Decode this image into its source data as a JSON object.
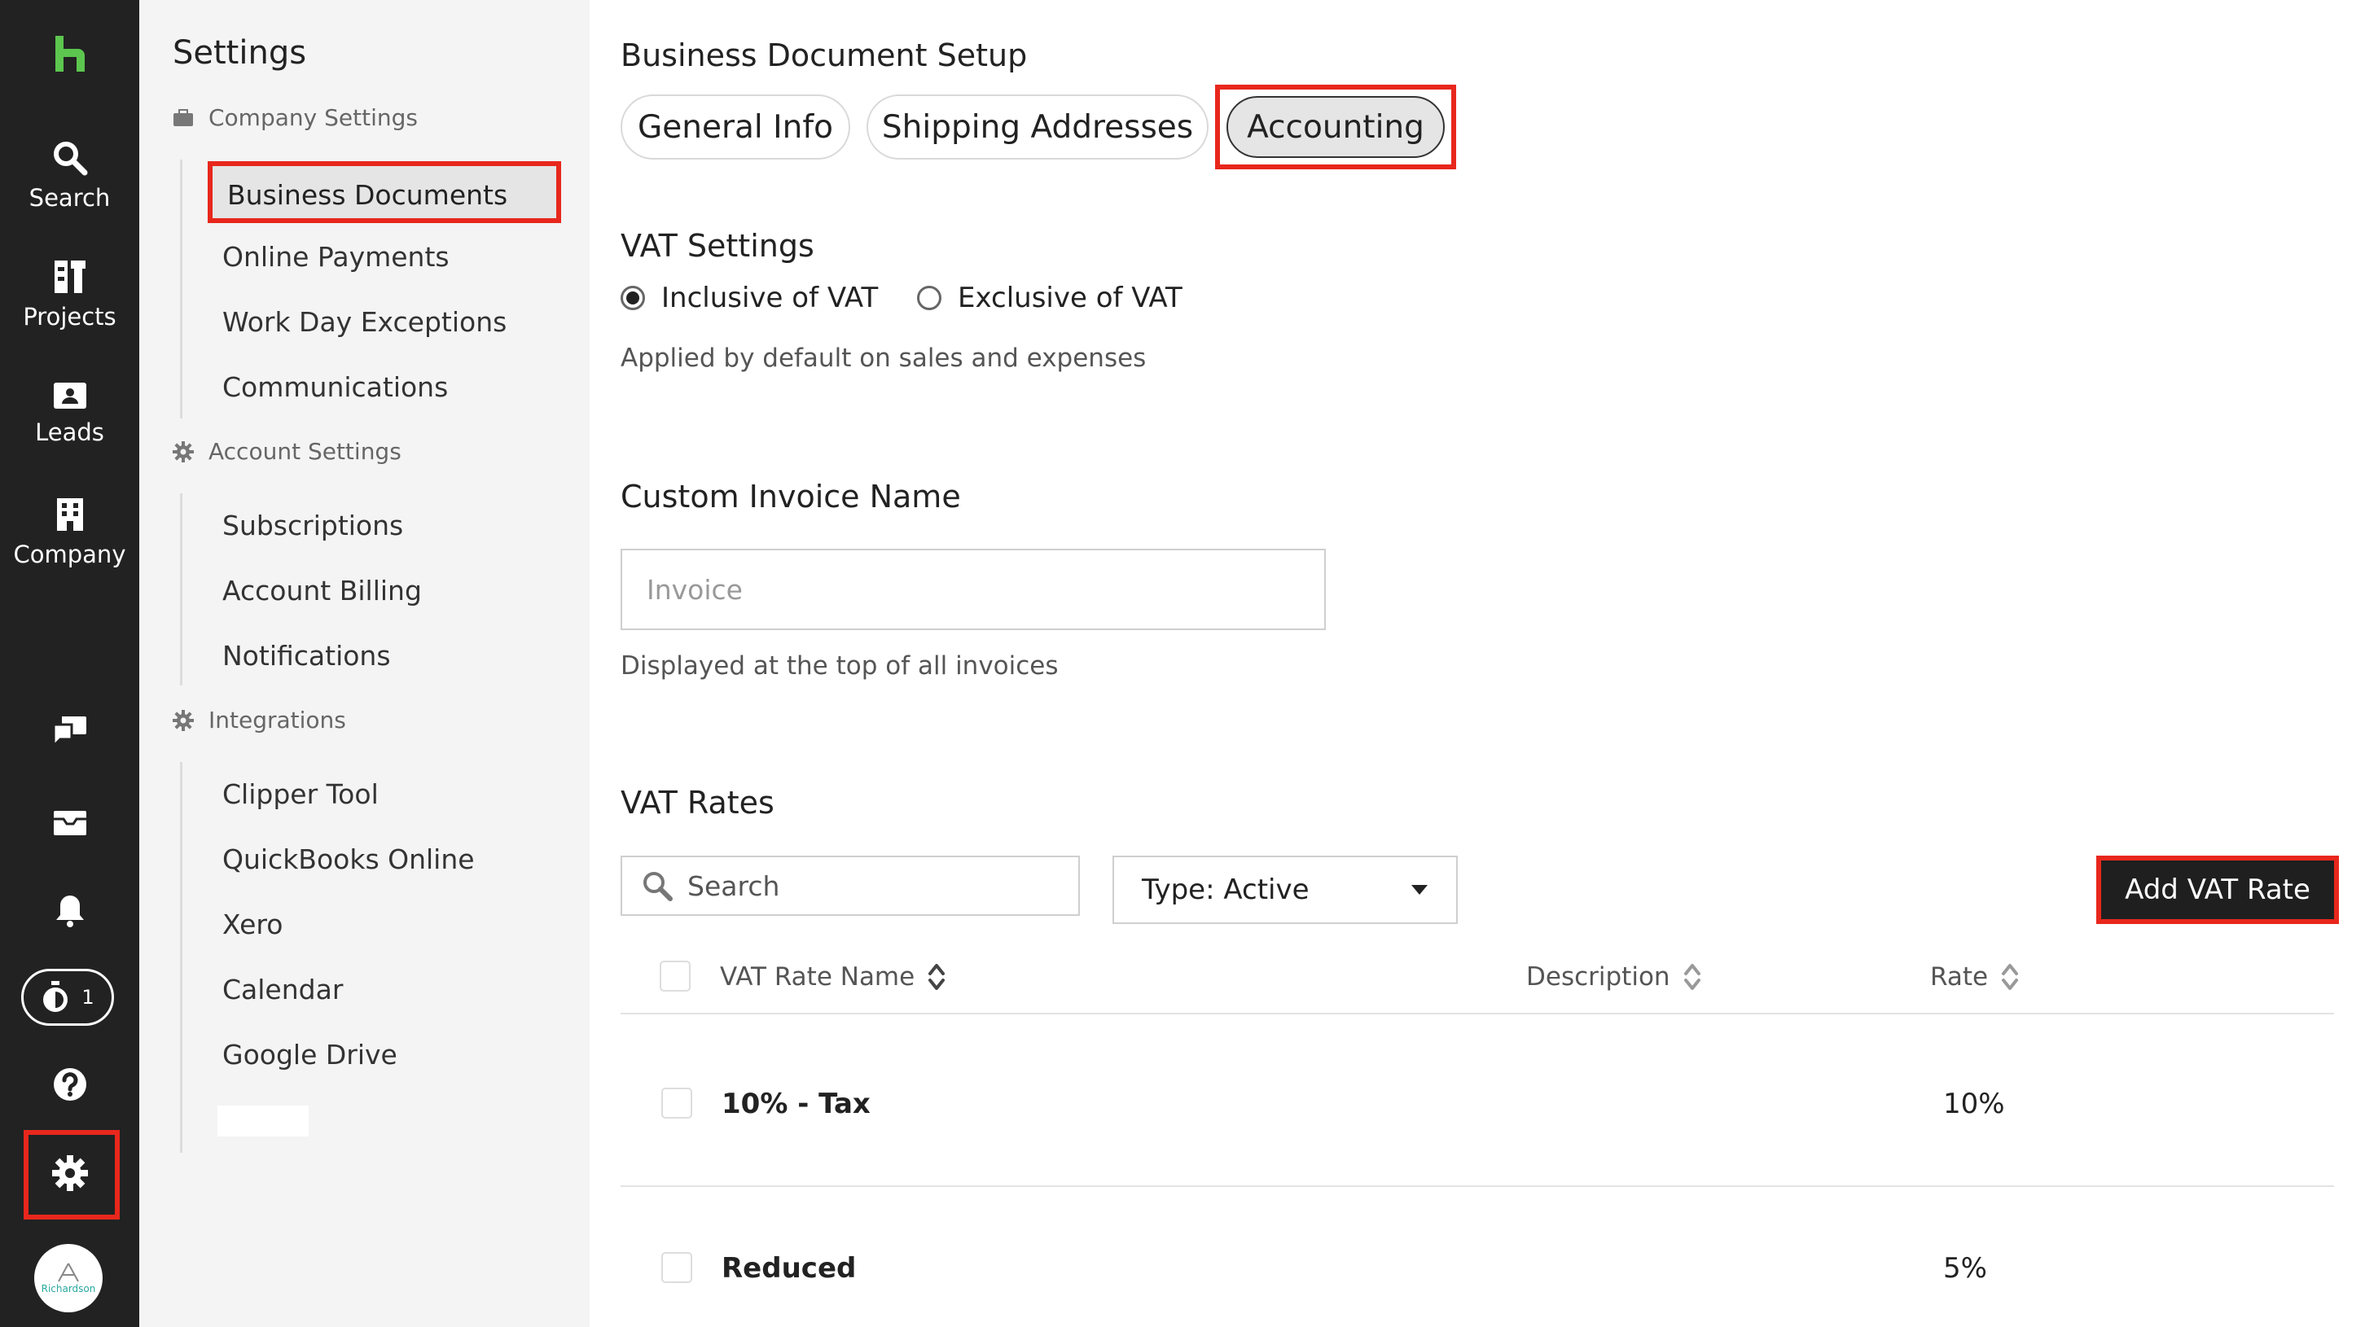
{
  "rail": {
    "items": [
      {
        "label": "Search",
        "icon": "search-icon"
      },
      {
        "label": "Projects",
        "icon": "projects-icon"
      },
      {
        "label": "Leads",
        "icon": "leads-icon"
      },
      {
        "label": "Company",
        "icon": "company-icon"
      }
    ],
    "timer_count": "1",
    "avatar_text": "Richardson"
  },
  "settings": {
    "title": "Settings",
    "groups": [
      {
        "heading": "Company Settings",
        "items": [
          "Business Documents",
          "Online Payments",
          "Work Day Exceptions",
          "Communications"
        ]
      },
      {
        "heading": "Account Settings",
        "items": [
          "Subscriptions",
          "Account Billing",
          "Notifications"
        ]
      },
      {
        "heading": "Integrations",
        "items": [
          "Clipper Tool",
          "QuickBooks Online",
          "Xero",
          "Calendar",
          "Google Drive"
        ]
      }
    ],
    "active_item": "Business Documents"
  },
  "main": {
    "title": "Business Document Setup",
    "tabs": [
      "General Info",
      "Shipping Addresses",
      "Accounting"
    ],
    "active_tab": "Accounting",
    "vat_settings": {
      "heading": "VAT Settings",
      "options": [
        "Inclusive of VAT",
        "Exclusive of VAT"
      ],
      "selected": "Inclusive of VAT",
      "helper": "Applied by default on sales and expenses"
    },
    "custom_invoice": {
      "heading": "Custom Invoice Name",
      "value": "",
      "placeholder": "Invoice",
      "helper": "Displayed at the top of all invoices"
    },
    "vat_rates": {
      "heading": "VAT Rates",
      "search_placeholder": "Search",
      "type_filter": "Type: Active",
      "add_button": "Add VAT Rate",
      "columns": [
        "VAT Rate Name",
        "Description",
        "Rate"
      ],
      "rows": [
        {
          "name": "10% - Tax",
          "description": "",
          "rate": "10%"
        },
        {
          "name": "Reduced",
          "description": "",
          "rate": "5%"
        }
      ]
    }
  },
  "colors": {
    "rail_bg": "#222222",
    "brand_green": "#5cc64f",
    "highlight_red": "#e8271c",
    "settings_bg": "#f4f4f4"
  }
}
